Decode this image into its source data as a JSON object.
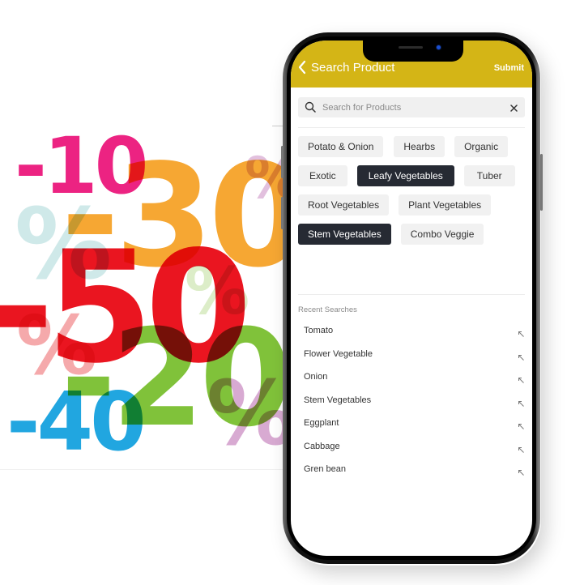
{
  "promo": {
    "numbers": [
      "-10",
      "-30",
      "-50",
      "-20",
      "-40"
    ],
    "percent_symbol": "%",
    "colors": {
      "pink": "#ea1e7c",
      "orange": "#f6a22a",
      "red": "#e8101c",
      "green": "#7fc236",
      "blue": "#1ca3e0",
      "light_teal": "#cce8e8",
      "light_pink": "#f4a6a8",
      "lilac": "#d6a8cf",
      "light_green": "#dbecc6"
    }
  },
  "app": {
    "header": {
      "title": "Search Product",
      "submit_label": "Submit",
      "back_icon": "chevron-left-icon",
      "background": "#d4b516"
    },
    "search": {
      "placeholder": "Search for Products",
      "value": "",
      "search_icon": "search-icon",
      "clear_icon": "close-icon"
    },
    "categories": [
      [
        {
          "label": "Potato & Onion",
          "selected": false
        },
        {
          "label": "Hearbs",
          "selected": false
        },
        {
          "label": "Organic",
          "selected": false
        }
      ],
      [
        {
          "label": "Exotic",
          "selected": false
        },
        {
          "label": "Leafy Vegetables",
          "selected": true
        },
        {
          "label": "Tuber",
          "selected": false
        }
      ],
      [
        {
          "label": "Root Vegetables",
          "selected": false
        },
        {
          "label": "Plant Vegetables",
          "selected": false
        }
      ],
      [
        {
          "label": "Stem Vegetables",
          "selected": true
        },
        {
          "label": "Combo Veggie",
          "selected": false
        }
      ]
    ],
    "recent": {
      "label": "Recent Searches",
      "items": [
        "Tomato",
        "Flower Vegetable",
        "Onion",
        "Stem Vegetables",
        "Eggplant",
        "Cabbage",
        "Gren bean"
      ],
      "item_icon": "arrow-up-left-icon"
    },
    "selected_chip_color": "#262a33"
  }
}
